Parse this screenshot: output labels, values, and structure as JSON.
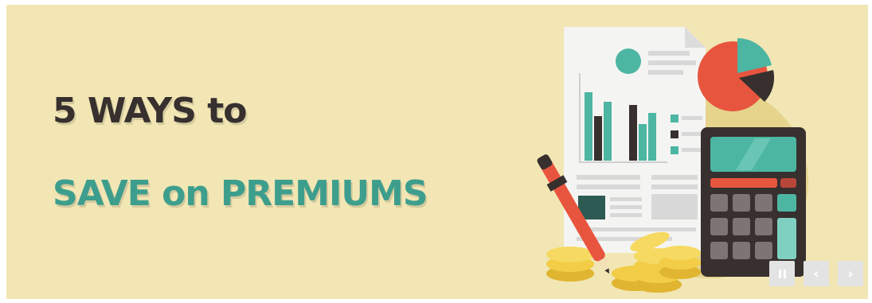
{
  "banner": {
    "line1": "5 WAYS to",
    "line2": "SAVE on PREMIUMS"
  },
  "controls": {
    "pause_icon": "pause-icon",
    "prev_label": "‹",
    "next_label": "›"
  },
  "colors": {
    "background": "#f2e6b4",
    "heading_dark": "#37302f",
    "heading_teal": "#3e9e8d",
    "accent_red": "#e8553f",
    "accent_teal": "#4cb6a2"
  }
}
